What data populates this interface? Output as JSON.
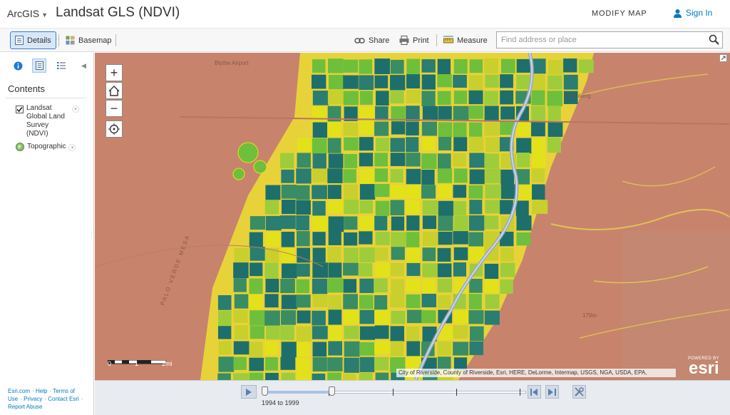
{
  "header": {
    "brand": "ArcGIS",
    "title": "Landsat GLS (NDVI)",
    "modify_map": "MODIFY MAP",
    "sign_in": "Sign In"
  },
  "toolbar": {
    "details": "Details",
    "basemap": "Basemap",
    "share": "Share",
    "print": "Print",
    "measure": "Measure",
    "search_placeholder": "Find address or place"
  },
  "panel": {
    "tabs": [
      "about",
      "content",
      "legend"
    ],
    "contents_title": "Contents",
    "layers": [
      {
        "name": "Landsat Global Land Survey (NDVI)",
        "checked": true
      },
      {
        "name": "Topographic",
        "basemap": true
      }
    ],
    "footer_links": [
      "Esri.com",
      "Help",
      "Terms of Use",
      "Privacy",
      "Contact Esri",
      "Report Abuse"
    ]
  },
  "map": {
    "place_labels": [
      "Blythe Airport",
      "Ehrenberg",
      "PALO VERDE MESA",
      "179m"
    ],
    "scale_labels": [
      "0",
      "1",
      "2mi"
    ],
    "attribution": "City of Riverside, County of Riverside, Esri, HERE, DeLorme, Intermap, USGS, NGA, USDA, EPA,",
    "powered_by": "POWERED BY",
    "esri": "esri",
    "colors": {
      "desert": "#c8836d",
      "crop_dark": "#1e6f6b",
      "crop_yellow": "#e3e21a",
      "crop_green": "#6fbf3c",
      "river": "#9aa9c7"
    }
  },
  "time_slider": {
    "label": "1994 to 1999",
    "range_start_fraction": 0,
    "range_end_fraction": 0.25
  }
}
